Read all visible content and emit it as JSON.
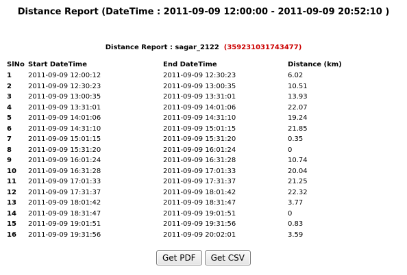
{
  "header": {
    "title": "Distance Report (DateTime : 2011-09-09 12:00:00  - 2011-09-09 20:52:10 )"
  },
  "report": {
    "subtitle_label": "Distance Report : sagar_2122",
    "device_id": "(359231031743477)"
  },
  "table": {
    "columns": [
      "SlNo",
      "Start DateTime",
      "End DateTime",
      "Distance (km)"
    ],
    "rows": [
      [
        "1",
        "2011-09-09 12:00:12",
        "2011-09-09 12:30:23",
        "6.02"
      ],
      [
        "2",
        "2011-09-09 12:30:23",
        "2011-09-09 13:00:35",
        "10.51"
      ],
      [
        "3",
        "2011-09-09 13:00:35",
        "2011-09-09 13:31:01",
        "13.93"
      ],
      [
        "4",
        "2011-09-09 13:31:01",
        "2011-09-09 14:01:06",
        "22.07"
      ],
      [
        "5",
        "2011-09-09 14:01:06",
        "2011-09-09 14:31:10",
        "19.24"
      ],
      [
        "6",
        "2011-09-09 14:31:10",
        "2011-09-09 15:01:15",
        "21.85"
      ],
      [
        "7",
        "2011-09-09 15:01:15",
        "2011-09-09 15:31:20",
        "0.35"
      ],
      [
        "8",
        "2011-09-09 15:31:20",
        "2011-09-09 16:01:24",
        "0"
      ],
      [
        "9",
        "2011-09-09 16:01:24",
        "2011-09-09 16:31:28",
        "10.74"
      ],
      [
        "10",
        "2011-09-09 16:31:28",
        "2011-09-09 17:01:33",
        "20.04"
      ],
      [
        "11",
        "2011-09-09 17:01:33",
        "2011-09-09 17:31:37",
        "21.25"
      ],
      [
        "12",
        "2011-09-09 17:31:37",
        "2011-09-09 18:01:42",
        "22.32"
      ],
      [
        "13",
        "2011-09-09 18:01:42",
        "2011-09-09 18:31:47",
        "3.77"
      ],
      [
        "14",
        "2011-09-09 18:31:47",
        "2011-09-09 19:01:51",
        "0"
      ],
      [
        "15",
        "2011-09-09 19:01:51",
        "2011-09-09 19:31:56",
        "0.83"
      ],
      [
        "16",
        "2011-09-09 19:31:56",
        "2011-09-09 20:02:01",
        "3.59"
      ]
    ]
  },
  "buttons": {
    "pdf_label": "Get PDF",
    "csv_label": "Get CSV"
  },
  "colors": {
    "device_id": "#cc0000"
  }
}
